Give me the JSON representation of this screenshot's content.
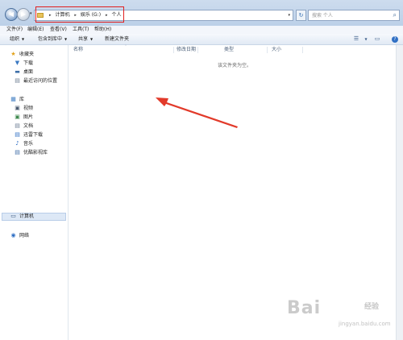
{
  "address": {
    "crumbs": [
      "计算机",
      "娱乐 (G:)",
      "个人"
    ],
    "search_placeholder": "搜索 个人"
  },
  "menu": {
    "items": [
      "文件(F)",
      "编辑(E)",
      "查看(V)",
      "工具(T)",
      "帮助(H)"
    ]
  },
  "toolbar": {
    "organize": "组织",
    "include_in_library": "包含到库中",
    "share": "共享",
    "new_folder": "新建文件夹"
  },
  "nav": {
    "favorites": "收藏夹",
    "downloads": "下载",
    "desktop": "桌面",
    "recent": "最近访问的位置",
    "libraries": "库",
    "videos": "视频",
    "pictures": "图片",
    "documents": "文档",
    "thunder": "迅雷下载",
    "music": "音乐",
    "youku": "优酷影视库",
    "computer": "计算机",
    "network": "网络"
  },
  "columns": {
    "name": "名称",
    "modified": "修改日期",
    "type": "类型",
    "size": "大小"
  },
  "content": {
    "empty_message": "该文件夹为空。"
  },
  "watermark": {
    "brand": "Bai",
    "brand_cn": "经验",
    "url": "jingyan.baidu.com"
  },
  "colors": {
    "highlight_box": "#e02020",
    "annotation_arrow": "#e23a2a",
    "selected_item": "#dde8f6"
  }
}
